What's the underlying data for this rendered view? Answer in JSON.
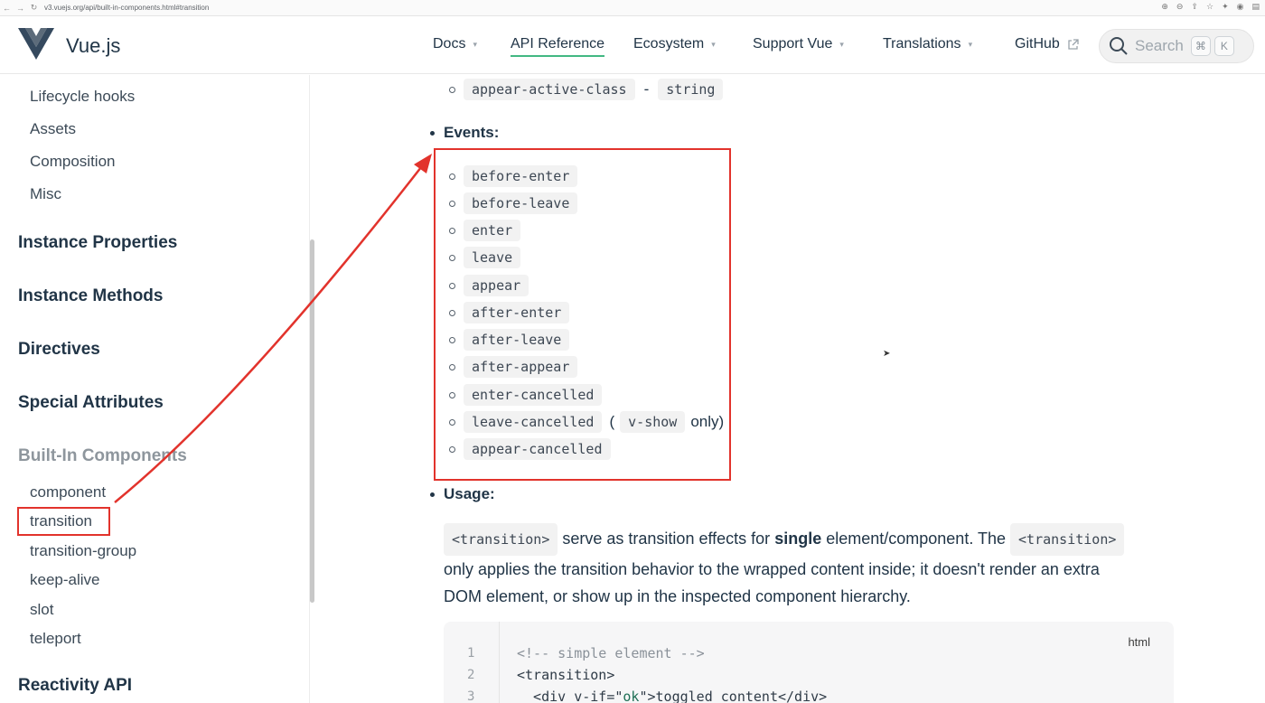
{
  "browser": {
    "url": "v3.vuejs.org/api/built-in-components.html#transition"
  },
  "header": {
    "brand": "Vue.js",
    "nav": [
      {
        "label": "Docs",
        "caret": "▾"
      },
      {
        "label": "API Reference",
        "caret": ""
      },
      {
        "label": "Ecosystem",
        "caret": "▾"
      },
      {
        "label": "Support Vue",
        "caret": "▾"
      },
      {
        "label": "Translations",
        "caret": "▾"
      },
      {
        "label": "GitHub",
        "caret": ""
      }
    ],
    "search": {
      "placeholder": "Search",
      "key1": "⌘",
      "key2": "K"
    }
  },
  "sidebar": {
    "top_items": [
      "Lifecycle hooks",
      "Assets",
      "Composition",
      "Misc"
    ],
    "sections": [
      "Instance Properties",
      "Instance Methods",
      "Directives",
      "Special Attributes",
      "Built-In Components"
    ],
    "components": [
      "component",
      "transition",
      "transition-group",
      "keep-alive",
      "slot",
      "teleport"
    ],
    "last_section": "Reactivity API"
  },
  "content": {
    "prev_prop": {
      "name": "appear-active-class",
      "sep": "-",
      "type": "string"
    },
    "events_label": "Events:",
    "events": [
      "before-enter",
      "before-leave",
      "enter",
      "leave",
      "appear",
      "after-enter",
      "after-leave",
      "after-appear",
      "enter-cancelled",
      "leave-cancelled",
      "appear-cancelled"
    ],
    "leave_cancelled_note": {
      "open": "(",
      "code": "v-show",
      "close": "only)"
    },
    "usage_label": "Usage:",
    "usage_text": {
      "tag": "<transition>",
      "part1": "serve as transition effects for",
      "bold": "single",
      "part2": "element/component. The",
      "tag2": "<transition>",
      "line2": "only applies the transition behavior to the wrapped content inside; it doesn't render an extra",
      "line3": "DOM element, or show up in the inspected component hierarchy."
    },
    "code": {
      "lang": "html",
      "line_numbers": [
        "1",
        "2",
        "3"
      ],
      "line1": "<!-- simple element -->",
      "line2": "<transition>",
      "line3_a": "  <div v-if=\"",
      "line3_b": "ok",
      "line3_c": "\">toggled content</div>"
    }
  },
  "colors": {
    "accent": "#42b883",
    "annotation": "#e2332c"
  }
}
